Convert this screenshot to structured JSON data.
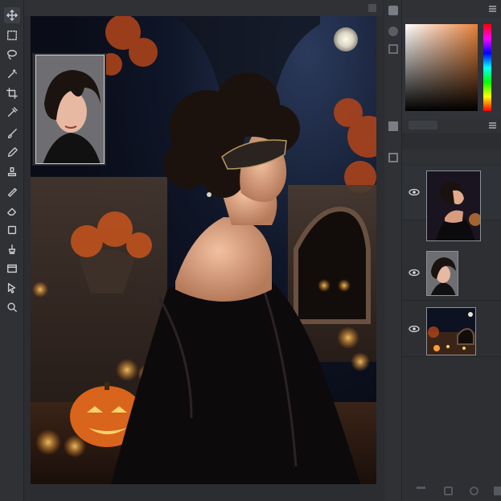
{
  "app": {
    "name": "photo-editor"
  },
  "toolbar": {
    "tools": [
      {
        "name": "move"
      },
      {
        "name": "marquee"
      },
      {
        "name": "lasso"
      },
      {
        "name": "magic-wand"
      },
      {
        "name": "crop"
      },
      {
        "name": "eyedropper"
      },
      {
        "name": "brush"
      },
      {
        "name": "pencil"
      },
      {
        "name": "clone-stamp"
      },
      {
        "name": "healing"
      },
      {
        "name": "eraser"
      },
      {
        "name": "fill"
      },
      {
        "name": "text"
      },
      {
        "name": "shape"
      },
      {
        "name": "select"
      },
      {
        "name": "zoom"
      }
    ]
  },
  "color": {
    "current": "#e8813a",
    "accent": "#2f3135"
  },
  "layers": [
    {
      "name": "portrait-masked-woman",
      "visible": true
    },
    {
      "name": "navigator-portrait",
      "visible": true
    },
    {
      "name": "halloween-garden-background",
      "visible": true
    }
  ]
}
